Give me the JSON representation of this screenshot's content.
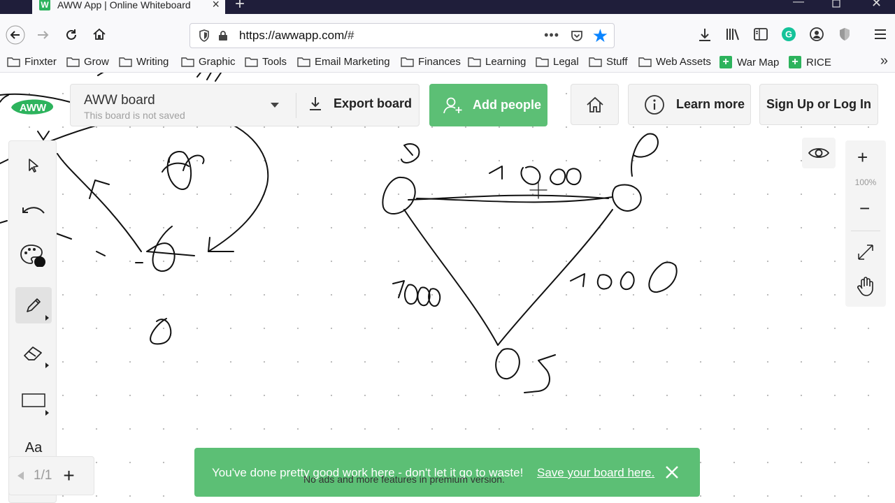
{
  "browser": {
    "tab_title": "AWW App | Online Whiteboard",
    "favicon_text": "W",
    "url_host": "https://awwapp.com/",
    "url_path": "#",
    "url_dots": "•••",
    "bookmarks": [
      {
        "label": "Finxter",
        "type": "folder"
      },
      {
        "label": "Grow",
        "type": "folder"
      },
      {
        "label": "Writing",
        "type": "folder"
      },
      {
        "label": "Graphic",
        "type": "folder"
      },
      {
        "label": "Tools",
        "type": "folder"
      },
      {
        "label": "Email Marketing",
        "type": "folder"
      },
      {
        "label": "Finances",
        "type": "folder"
      },
      {
        "label": "Learning",
        "type": "folder"
      },
      {
        "label": "Legal",
        "type": "folder"
      },
      {
        "label": "Stuff",
        "type": "folder"
      },
      {
        "label": "Web Assets",
        "type": "folder"
      },
      {
        "label": "War Map",
        "type": "green-plus"
      },
      {
        "label": "RICE",
        "type": "green-plus"
      }
    ],
    "bookmarks_overflow": "»"
  },
  "app": {
    "logo_text": "AWW",
    "board": {
      "name": "AWW board",
      "subtitle": "This board is not saved",
      "export_label": "Export board"
    },
    "add_people_label": "Add people",
    "learn_more_label": "Learn more",
    "signup_label": "Sign Up or Log In",
    "zoom": {
      "plus": "+",
      "level": "100%",
      "minus": "−"
    },
    "left_tools": [
      {
        "name": "select-tool",
        "icon": "cursor-icon"
      },
      {
        "name": "undo-tool",
        "icon": "undo-icon"
      },
      {
        "name": "color-tool",
        "icon": "palette-icon"
      },
      {
        "name": "pen-tool",
        "icon": "pencil-icon",
        "active": true
      },
      {
        "name": "eraser-tool",
        "icon": "eraser-icon"
      },
      {
        "name": "shape-tool",
        "icon": "rectangle-icon"
      },
      {
        "name": "text-tool",
        "icon": "text-icon",
        "label": "Aa"
      }
    ],
    "pager": {
      "current": "1/1",
      "add": "+"
    },
    "toast": {
      "message": "You've done pretty good work here - don't let it go to waste!",
      "link": "Save your board here.",
      "sub": "No ads and more features in premium version."
    }
  }
}
